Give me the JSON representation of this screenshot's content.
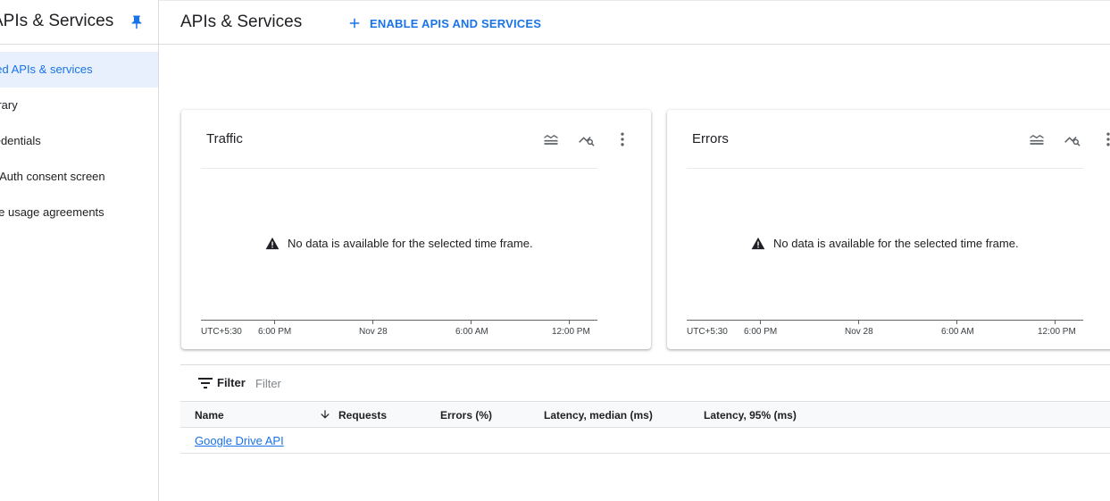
{
  "sidebar": {
    "title": "APIs & Services",
    "pin_icon": "pin-icon",
    "items": [
      {
        "label": "Enabled APIs & services",
        "active": true
      },
      {
        "label": "Library",
        "active": false
      },
      {
        "label": "Credentials",
        "active": false
      },
      {
        "label": "OAuth consent screen",
        "active": false
      },
      {
        "label": "Page usage agreements",
        "active": false
      }
    ]
  },
  "header": {
    "title": "APIs & Services",
    "enable_button": "ENABLE APIS AND SERVICES",
    "enable_icon": "plus-icon"
  },
  "cards": [
    {
      "title": "Traffic",
      "icons": [
        "legend-icon",
        "explore-chart-icon",
        "more-vert-icon"
      ],
      "no_data": "No data is available for the selected time frame.",
      "axis_labels": [
        "UTC+5:30",
        "6:00 PM",
        "Nov 28",
        "6:00 AM",
        "12:00 PM"
      ]
    },
    {
      "title": "Errors",
      "icons": [
        "legend-icon",
        "explore-chart-icon",
        "more-vert-icon"
      ],
      "no_data": "No data is available for the selected time frame.",
      "axis_labels": [
        "UTC+5:30",
        "6:00 PM",
        "Nov 28",
        "6:00 AM",
        "12:00 PM"
      ]
    }
  ],
  "filter": {
    "label": "Filter",
    "placeholder": "Filter",
    "icon": "filter-list-icon"
  },
  "table": {
    "columns": [
      "Name",
      "Requests",
      "Errors (%)",
      "Latency, median (ms)",
      "Latency, 95% (ms)"
    ],
    "sort_icon": "arrow-downward-icon",
    "rows": [
      {
        "name": "Google Drive API",
        "requests": "",
        "errors": "",
        "latency_median": "",
        "latency_95": ""
      }
    ]
  },
  "colors": {
    "accent": "#1a73e8",
    "active_bg": "#e8f0fe",
    "divider": "#dadce0"
  }
}
